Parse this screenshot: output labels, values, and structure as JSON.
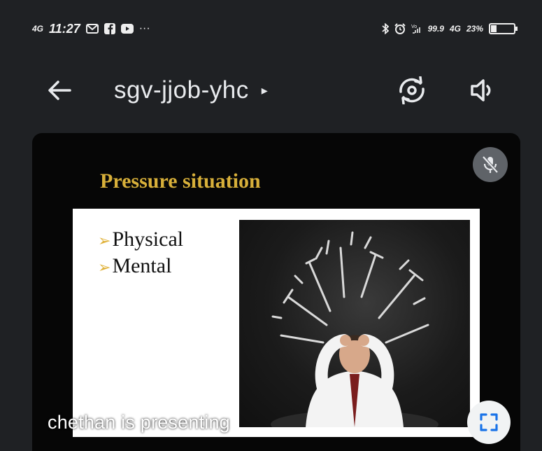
{
  "status_bar": {
    "network_left": "4G",
    "time": "11:27",
    "more": "···",
    "speed": "99.9",
    "network_right": "4G",
    "battery": "23%",
    "battery_level": 0.23
  },
  "header": {
    "title": "sgv-jjob-yhc",
    "title_caret": "▸"
  },
  "slide": {
    "title": "Pressure situation",
    "bullets": [
      "Physical",
      "Mental"
    ],
    "bullet_marker": "➢"
  },
  "tile": {
    "presenting_text": "chethan is presenting"
  },
  "icons": {
    "back": "arrow-left-icon",
    "switch_camera": "switch-camera-icon",
    "audio": "volume-icon",
    "mic_off": "mic-off-icon",
    "fullscreen": "fullscreen-icon"
  }
}
